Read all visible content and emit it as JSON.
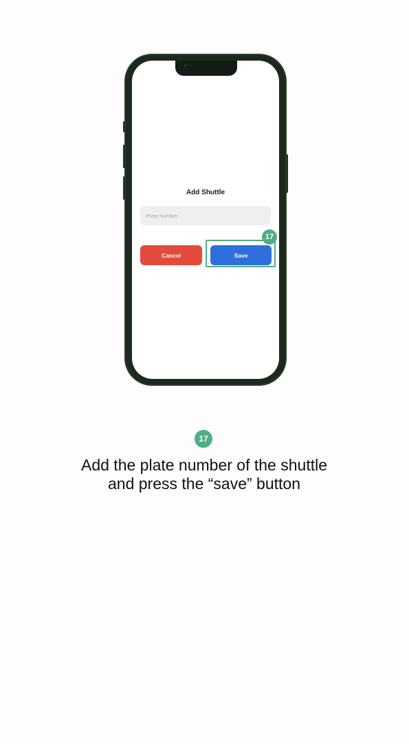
{
  "dialog": {
    "title": "Add Shuttle",
    "plate_placeholder": "Plate Number",
    "plate_value": "",
    "cancel_label": "Cancel",
    "save_label": "Save"
  },
  "step": {
    "number": "17",
    "instruction": "Add the plate number of the shuttle and press the “save” button"
  },
  "colors": {
    "cancel": "#e34b3c",
    "save": "#2e6fdc",
    "highlight": "#4fae87",
    "phone_frame": "#1c2a1e"
  }
}
